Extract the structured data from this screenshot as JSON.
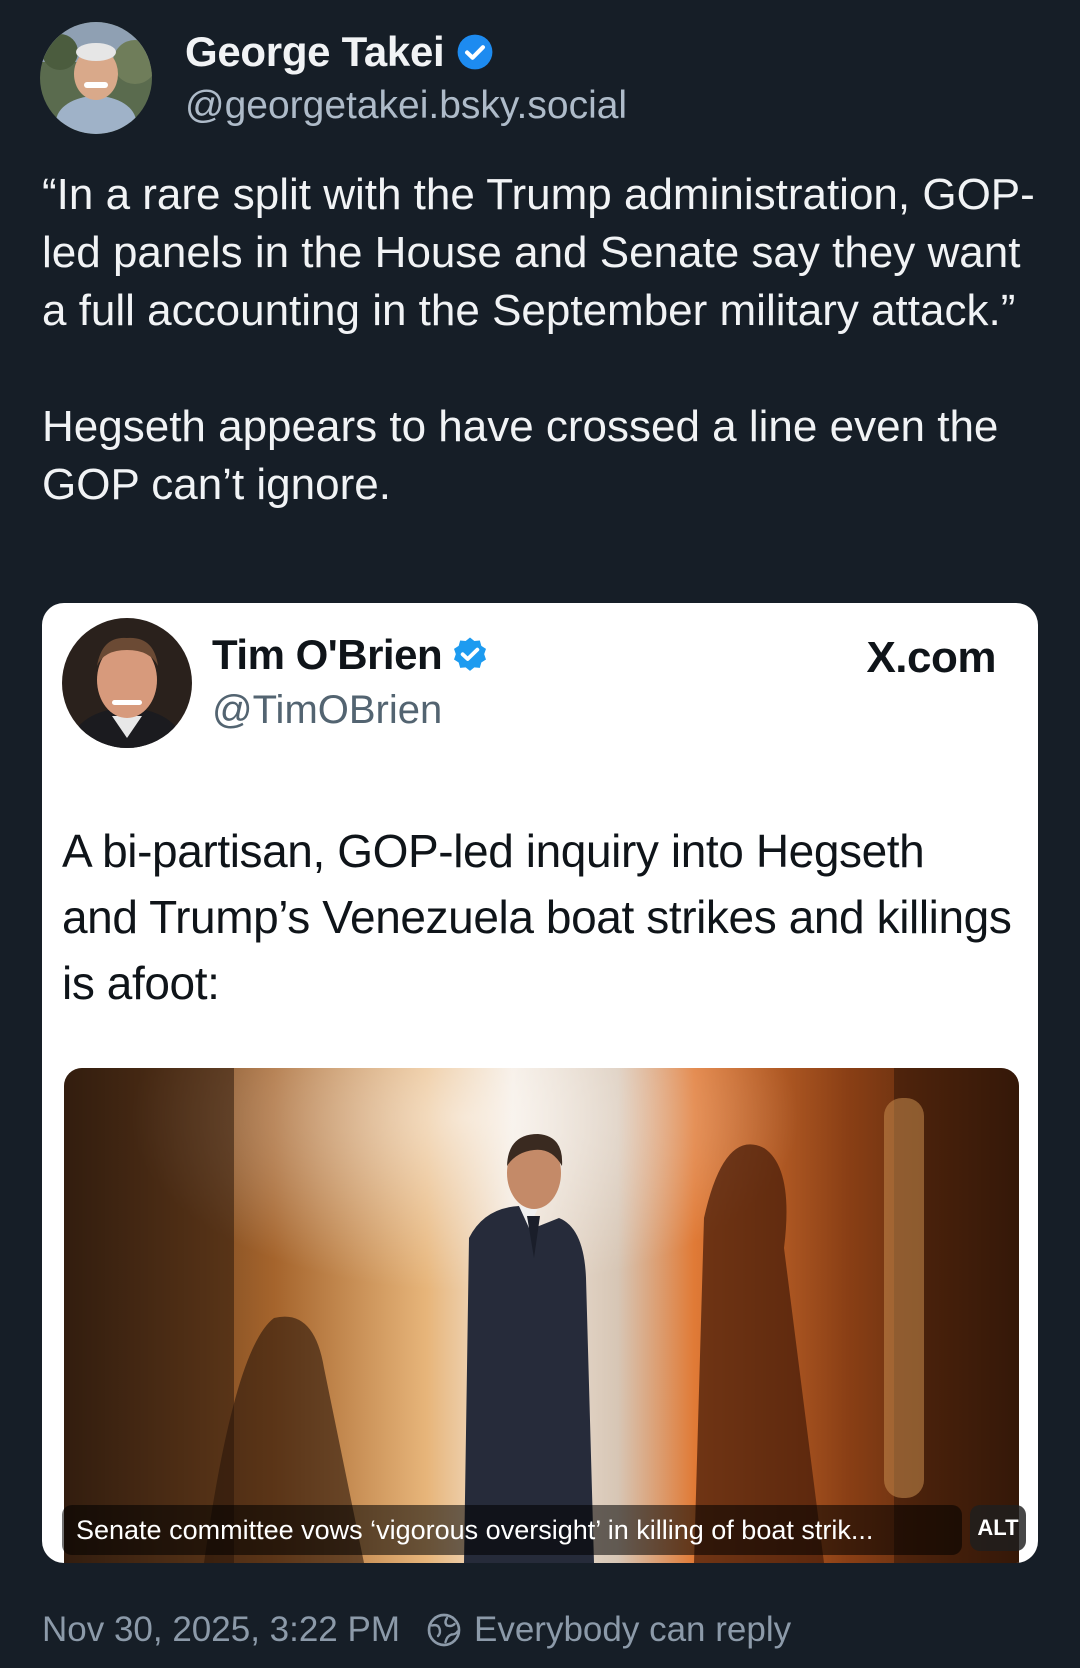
{
  "author": {
    "display_name": "George Takei",
    "handle": "@georgetakei.bsky.social",
    "verified": true
  },
  "post": {
    "paragraphs": [
      "“In a rare split with the Trump administration, GOP-led panels in the House and Senate say they want a full accounting in the September military attack.”",
      "Hegseth appears to have crossed a line even the GOP can’t ignore."
    ]
  },
  "quoted_card": {
    "display_name": "Tim O'Brien",
    "handle": "@TimOBrien",
    "verified": true,
    "site": "X.com",
    "text": "A bi-partisan, GOP-led inquiry into Hegseth and Trump’s Venezuela boat strikes and killings is afoot:",
    "image_caption": "Senate committee vows ‘vigorous oversight’ in killing of boat strik...",
    "alt_label": "ALT"
  },
  "footer": {
    "timestamp": "Nov 30, 2025, 3:22 PM",
    "reply_setting": "Everybody can reply"
  },
  "icons": {
    "verified": "verified-check-icon",
    "reply": "globe-reply-icon"
  },
  "colors": {
    "background": "#161e27",
    "verified_blue": "#1d8bf0",
    "card_background": "#ffffff"
  }
}
